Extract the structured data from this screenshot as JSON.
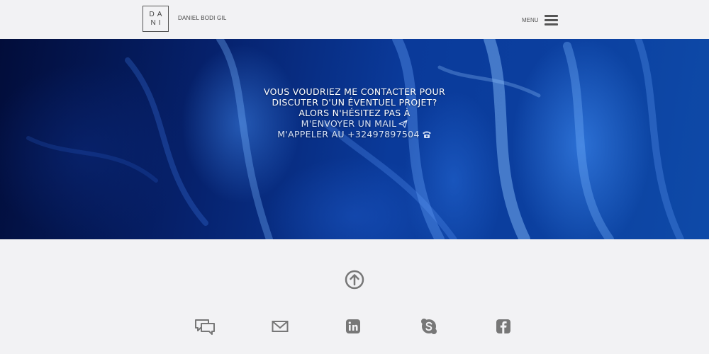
{
  "header": {
    "logo_line1": "DA",
    "logo_line2": "NI",
    "brand_name": "DANIEL BODI GIL",
    "menu_label": "MENU"
  },
  "hero": {
    "line1": "VOUS VOUDRIEZ ME CONTACTER POUR",
    "line2": "DISCUTER D'UN ÉVENTUEL PROJET?",
    "line3": "ALORS N'HÉSITEZ PAS À",
    "email_link": "M'ENVOYER UN MAIL",
    "phone_link": "M'APPELER AU +32497897504"
  },
  "footer": {
    "icons": [
      "arrow-up-circle-icon",
      "chat-icon",
      "mail-icon",
      "linkedin-icon",
      "skype-icon",
      "facebook-icon"
    ]
  },
  "colors": {
    "page_bg": "#f2f2f4",
    "icon_gray": "#777777",
    "hero_blue": "#0a3a9a"
  }
}
